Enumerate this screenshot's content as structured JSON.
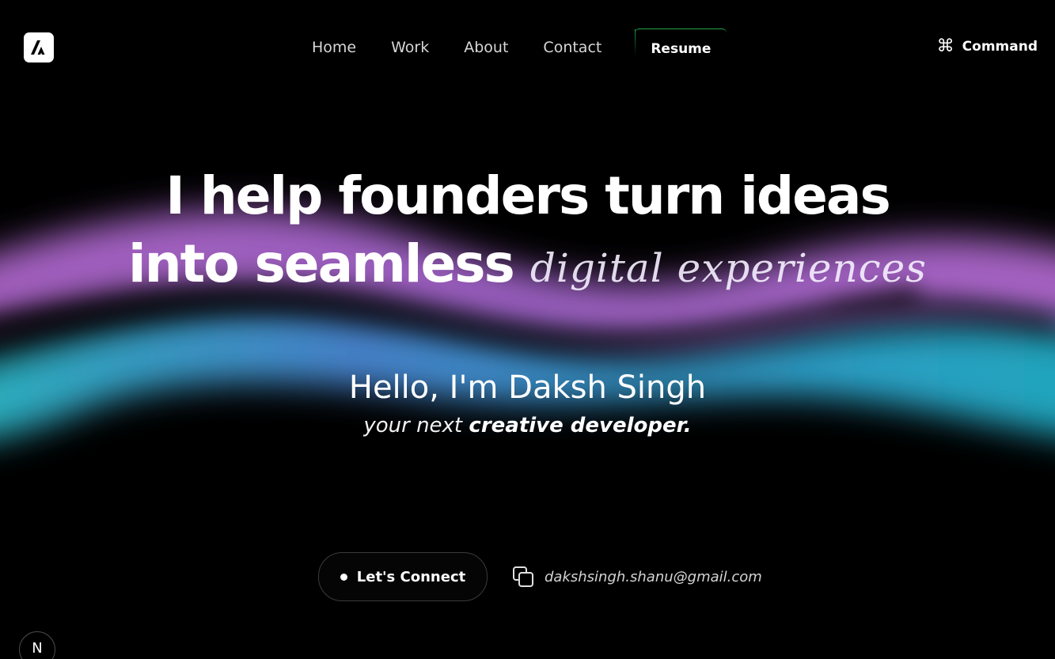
{
  "nav": {
    "logo_icon": "brand-logo-icon",
    "links": [
      "Home",
      "Work",
      "About",
      "Contact"
    ],
    "resume_label": "Resume",
    "command_label": "Command",
    "command_icon": "command-key-icon"
  },
  "hero": {
    "line1": "I help founders turn ideas",
    "line2_bold": "into seamless",
    "line2_script": "digital experiences",
    "greeting": "Hello, I'm Daksh Singh",
    "tagline_prefix": "your next",
    "tagline_emphasis": "creative developer."
  },
  "cta": {
    "connect_label": "Let's Connect",
    "email": "dakshsingh.shanu@gmail.com",
    "copy_icon": "copy-icon"
  },
  "badge": {
    "label": "N",
    "icon": "nextjs-icon"
  },
  "colors": {
    "background": "#000000",
    "wave_purple": "#c070e0",
    "wave_cyan": "#22b8d0",
    "resume_accent": "#1fa34a"
  }
}
